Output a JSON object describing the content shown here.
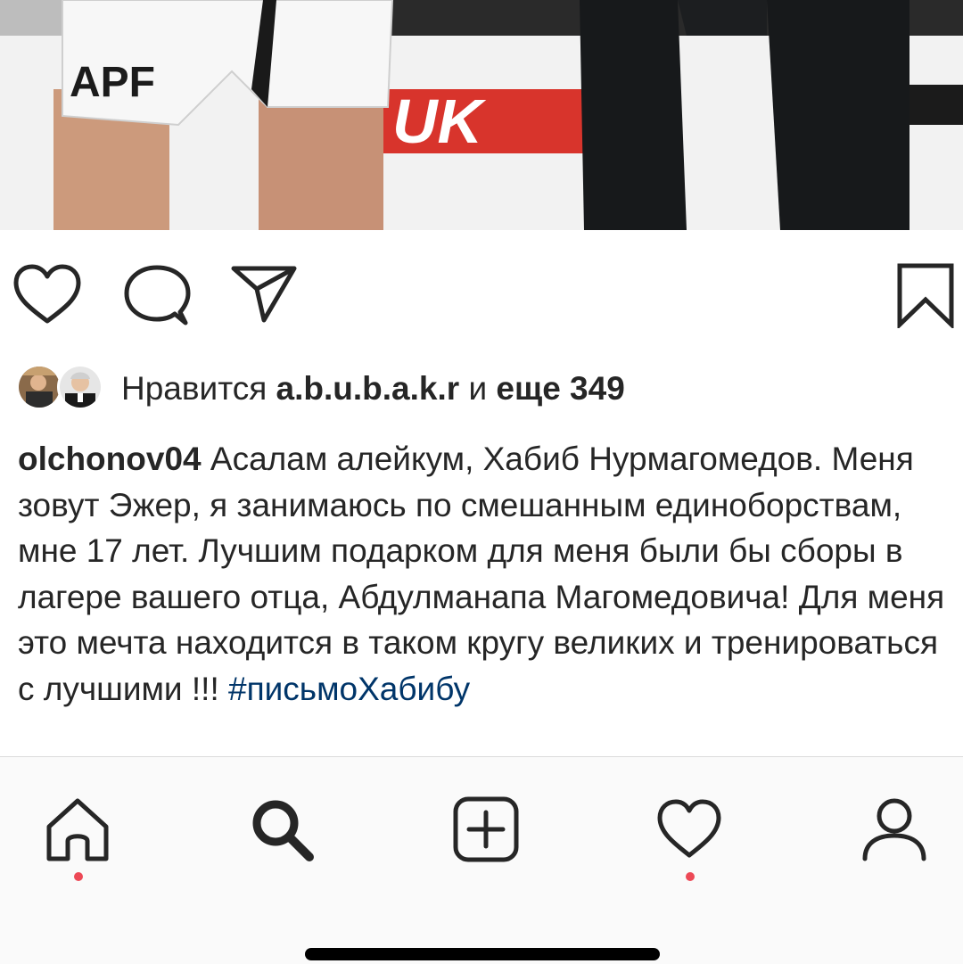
{
  "post": {
    "photo_shorts_text": "APF",
    "photo_banner_text": "UK"
  },
  "actions": {
    "like_icon": "heart-outline-icon",
    "comment_icon": "comment-bubble-icon",
    "share_icon": "paper-plane-icon",
    "save_icon": "bookmark-outline-icon"
  },
  "likes": {
    "prefix": "Нравится ",
    "username": "a.b.u.b.a.k.r",
    "middle": " и ",
    "others": "еще 349"
  },
  "caption": {
    "username": "olchonov04",
    "text": " Асалам алейкум, Хабиб Нурмагомедов. Меня зовут Эжер, я занимаюсь по смешанным единоборствам, мне 17 лет. Лучшим подарком для меня были бы сборы в лагере вашего отца, Абдулманапа Магомедовича! Для меня это мечта находится в таком кругу великих и тренироваться с лучшими !!! ",
    "hashtag": "#письмоХабибу"
  },
  "nav": {
    "items": [
      {
        "name": "home",
        "icon": "home-icon",
        "notification_dot": true
      },
      {
        "name": "search",
        "icon": "search-icon",
        "notification_dot": false
      },
      {
        "name": "new-post",
        "icon": "add-post-icon",
        "notification_dot": false
      },
      {
        "name": "activity",
        "icon": "heart-outline-icon",
        "notification_dot": true
      },
      {
        "name": "profile",
        "icon": "profile-icon",
        "notification_dot": false
      }
    ],
    "dot_color": "#ed4956"
  },
  "colors": {
    "text": "#262626",
    "hashtag": "#003569",
    "nav_background": "#fafafa"
  }
}
